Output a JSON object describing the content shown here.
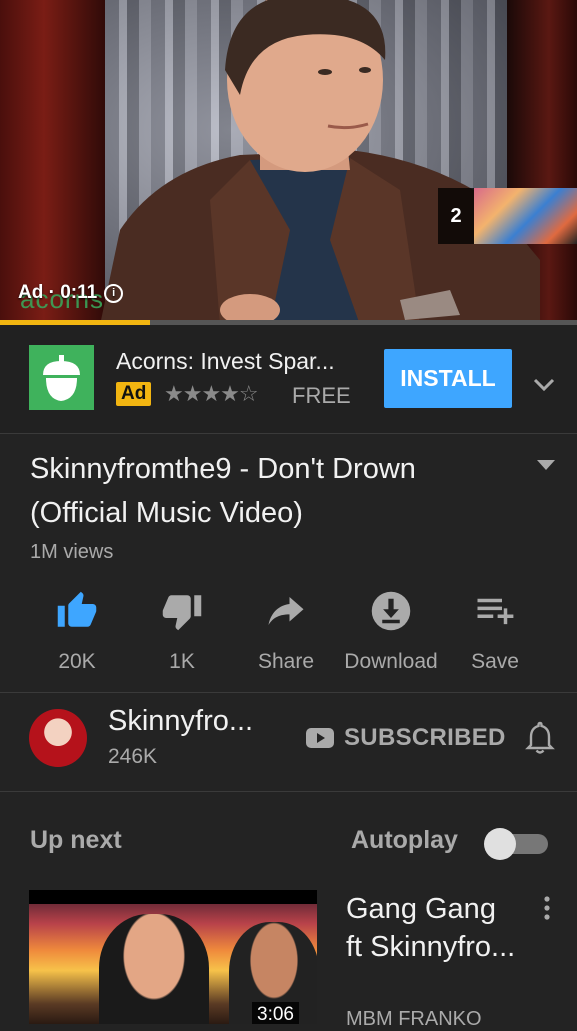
{
  "player": {
    "ad_label": "Ad · 0:11",
    "watermark": "acorns",
    "next_count": "2",
    "progress_fraction": 0.26
  },
  "ad": {
    "title": "Acorns: Invest Spar...",
    "badge": "Ad",
    "rating_stars": "★★★★☆",
    "rating_value": 4.5,
    "price": "FREE",
    "install_label": "INSTALL"
  },
  "video": {
    "title": "Skinnyfromthe9 - Don't Drown (Official Music Video)",
    "views": "1M views"
  },
  "actions": {
    "like": "20K",
    "dislike": "1K",
    "share": "Share",
    "download": "Download",
    "save": "Save"
  },
  "channel": {
    "name": "Skinnyfro...",
    "subscribers": "246K",
    "subscribed_label": "SUBSCRIBED"
  },
  "up_next": {
    "heading": "Up next",
    "autoplay_label": "Autoplay",
    "autoplay_on": false,
    "items": [
      {
        "title": "Gang Gang ft Skinnyfro...",
        "channel": "MBM FRANKO",
        "duration": "3:06"
      }
    ]
  },
  "colors": {
    "background": "#232323",
    "accent_blue": "#3ea6ff",
    "like_blue": "#3ea6ff",
    "ad_yellow": "#f2b511",
    "acorns_green": "#3fb25c"
  },
  "icons": [
    "info-icon",
    "acorn-icon",
    "chevron-down-icon",
    "thumbs-up-icon",
    "thumbs-down-icon",
    "share-icon",
    "download-icon",
    "playlist-add-icon",
    "youtube-icon",
    "bell-icon",
    "more-vert-icon"
  ]
}
